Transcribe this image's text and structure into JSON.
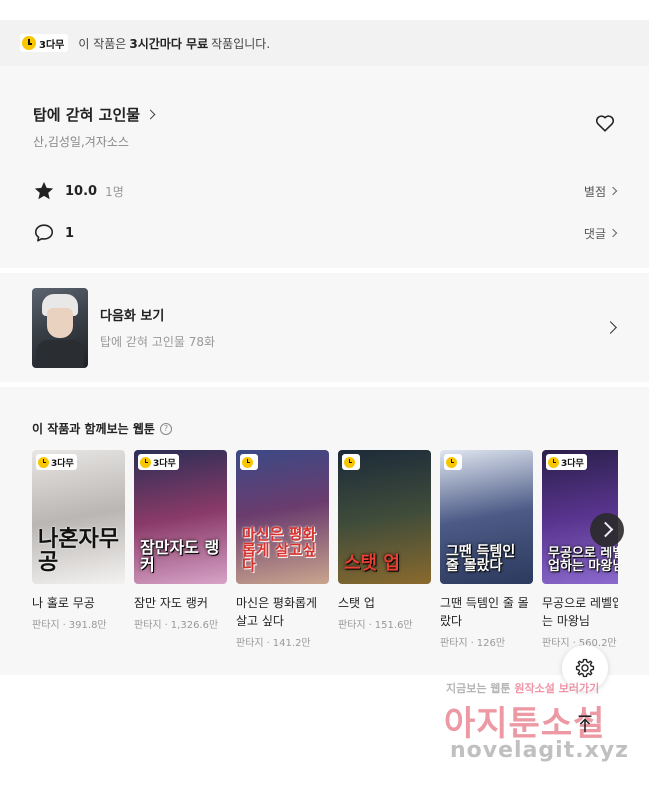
{
  "notice": {
    "badge": "3다무",
    "text_before": "이 작품은",
    "text_bold": "3시간마다 무료",
    "text_after": "작품입니다."
  },
  "work": {
    "title": "탑에 갇혀 고인물",
    "authors": "산,김성일,겨자소스"
  },
  "rating": {
    "score": "10.0",
    "count": "1명",
    "link": "별점"
  },
  "comments": {
    "count": "1",
    "link": "댓글"
  },
  "next_episode": {
    "label": "다음화 보기",
    "subtitle": "탑에 갇혀 고인물 78화"
  },
  "recommend": {
    "title": "이 작품과 함께보는 웹툰",
    "help": "?",
    "items": [
      {
        "badge": "3다무",
        "cover_text": "나혼자무공",
        "title": "나 홀로 무공",
        "genre": "판타지",
        "views": "391.8만"
      },
      {
        "badge": "3다무",
        "cover_text": "잠만자도 랭커",
        "title": "잠만 자도 랭커",
        "genre": "판타지",
        "views": "1,326.6만"
      },
      {
        "badge": "",
        "cover_text": "마신은 평화롭게 살고싶다",
        "title": "마신은 평화롭게 살고 싶다",
        "genre": "판타지",
        "views": "141.2만"
      },
      {
        "badge": "",
        "cover_text": "스탯 업",
        "title": "스탯 업",
        "genre": "판타지",
        "views": "151.6만"
      },
      {
        "badge": "",
        "cover_text": "그땐 득템인 줄 몰랐다",
        "title": "그땐 득템인 줄 몰랐다",
        "genre": "판타지",
        "views": "126만"
      },
      {
        "badge": "3다무",
        "cover_text": "무공으로 레벨업하는 마왕님",
        "title": "무공으로 레벨업하는 마왕님",
        "genre": "판타지",
        "views": "560.2만"
      }
    ]
  },
  "watermark": {
    "line1_a": "지금보는 웹툰",
    "line1_b": "원작소설 보러가기",
    "big": "아지툰소설",
    "url": "novelagit.xyz"
  },
  "icons": {
    "heart": "heart-icon",
    "star": "star-icon",
    "comment": "comment-icon",
    "gear": "gear-icon",
    "scroll_top": "arrow-up-icon",
    "next": "chevron-right-icon"
  },
  "colors": {
    "free_badge": "#f7c600",
    "background": "#f7f7f7"
  }
}
